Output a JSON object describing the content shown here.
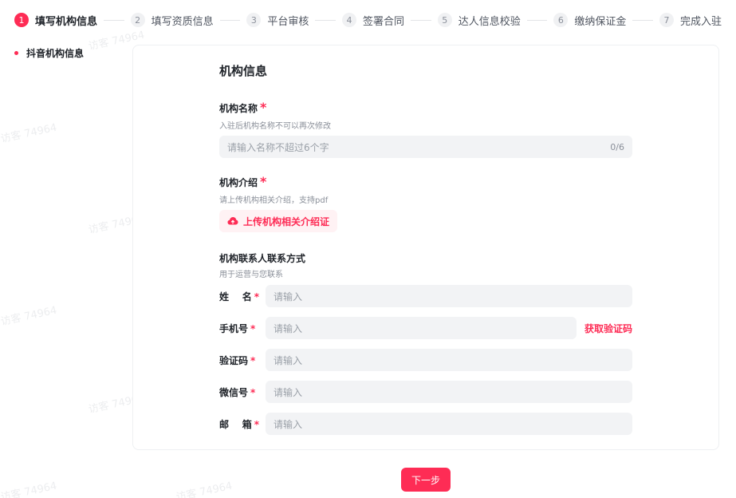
{
  "steps": [
    {
      "num": "1",
      "label": "填写机构信息"
    },
    {
      "num": "2",
      "label": "填写资质信息"
    },
    {
      "num": "3",
      "label": "平台审核"
    },
    {
      "num": "4",
      "label": "签署合同"
    },
    {
      "num": "5",
      "label": "达人信息校验"
    },
    {
      "num": "6",
      "label": "缴纳保证金"
    },
    {
      "num": "7",
      "label": "完成入驻"
    }
  ],
  "sidenav": {
    "item": "抖音机构信息"
  },
  "form": {
    "title": "机构信息",
    "name_field": {
      "label": "机构名称",
      "required_mark": "*",
      "hint": "入驻后机构名称不可以再次修改",
      "placeholder": "请输入名称不超过6个字",
      "counter": "0/6"
    },
    "intro_field": {
      "label": "机构介绍",
      "required_mark": "*",
      "hint": "请上传机构相关介绍，支持pdf",
      "upload_label": "上传机构相关介绍证"
    },
    "contact": {
      "title": "机构联系人联系方式",
      "hint": "用于运营与您联系",
      "rows": [
        {
          "label": "姓    名",
          "required_mark": "*",
          "placeholder": "请输入"
        },
        {
          "label": "手机号",
          "required_mark": "*",
          "placeholder": "请输入",
          "action": "获取验证码"
        },
        {
          "label": "验证码",
          "required_mark": "*",
          "placeholder": "请输入"
        },
        {
          "label": "微信号",
          "required_mark": "*",
          "placeholder": "请输入"
        },
        {
          "label": "邮    箱",
          "required_mark": "*",
          "placeholder": "请输入"
        }
      ]
    }
  },
  "next_button": "下一步",
  "watermark": "访客 74964",
  "colors": {
    "accent": "#fe2c55",
    "input_bg": "#f2f3f5"
  }
}
